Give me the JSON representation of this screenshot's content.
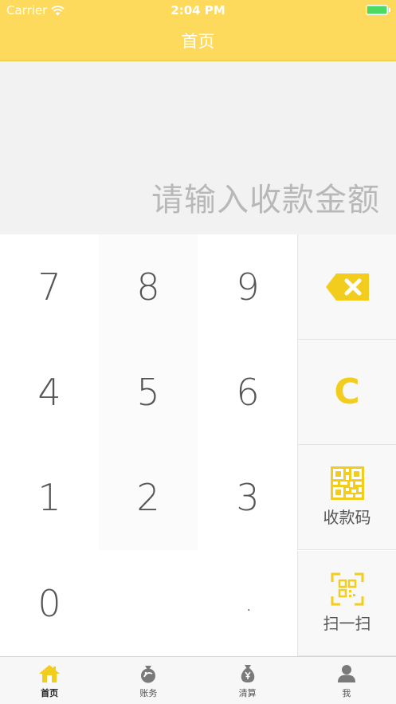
{
  "status_bar": {
    "carrier": "Carrier",
    "time": "2:04 PM"
  },
  "nav": {
    "title": "首页"
  },
  "amount": {
    "placeholder": "请输入收款金额"
  },
  "keypad": {
    "keys": [
      "7",
      "8",
      "9",
      "4",
      "5",
      "6",
      "1",
      "2",
      "3",
      "0",
      "."
    ],
    "clear_label": "C",
    "qr_code_label": "收款码",
    "scan_label": "扫一扫"
  },
  "tabbar": {
    "tabs": [
      {
        "label": "首页",
        "icon": "home-icon",
        "active": true
      },
      {
        "label": "账务",
        "icon": "money-bag-icon",
        "active": false
      },
      {
        "label": "清算",
        "icon": "yuan-bag-icon",
        "active": false
      },
      {
        "label": "我",
        "icon": "user-icon",
        "active": false
      }
    ]
  },
  "colors": {
    "accent": "#fdd95c",
    "icon_yellow": "#f3cd1d",
    "text": "#555555"
  }
}
